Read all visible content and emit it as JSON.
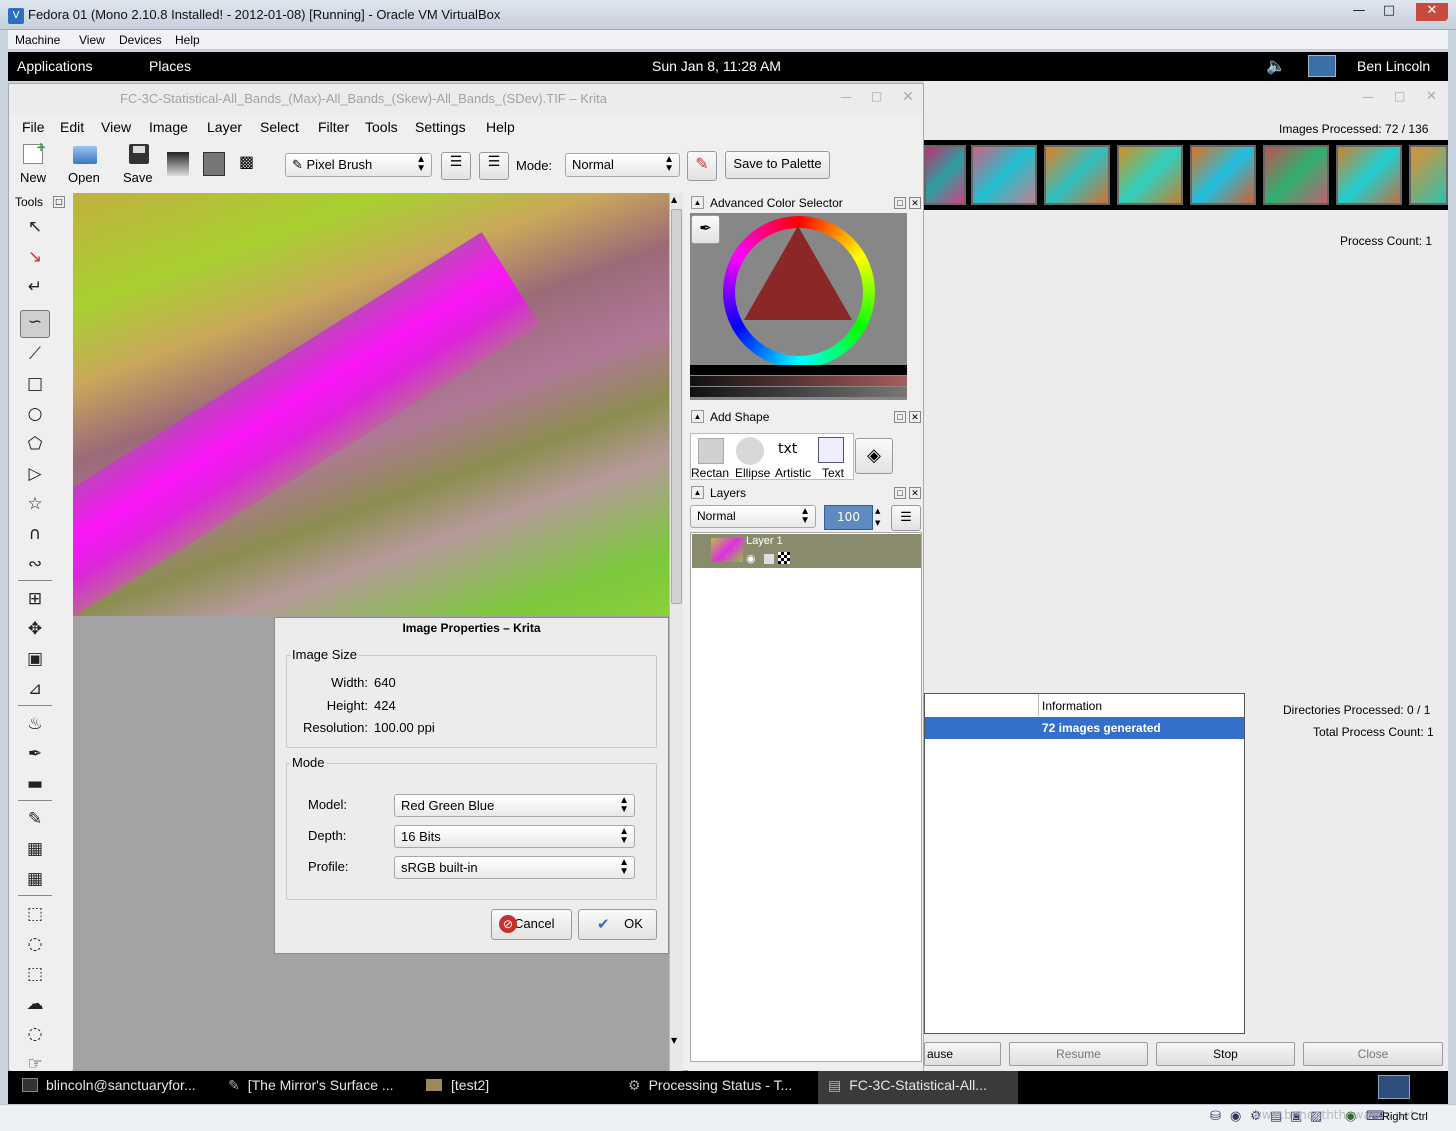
{
  "vbox": {
    "title": "Fedora 01 (Mono 2.10.8 Installed! - 2012-01-08) [Running] - Oracle VM VirtualBox",
    "menu": [
      "Machine",
      "View",
      "Devices",
      "Help"
    ],
    "host_key": "Right Ctrl"
  },
  "panel": {
    "applications": "Applications",
    "places": "Places",
    "clock": "Sun Jan  8, 11:28 AM",
    "user": "Ben Lincoln"
  },
  "krita": {
    "title": "FC-3C-Statistical-All_Bands_(Max)-All_Bands_(Skew)-All_Bands_(SDev).TIF – Krita",
    "menu": [
      "File",
      "Edit",
      "View",
      "Image",
      "Layer",
      "Select",
      "Filter",
      "Tools",
      "Settings",
      "Help"
    ],
    "toolbar": {
      "new": "New",
      "open": "Open",
      "save": "Save",
      "brush": "Pixel Brush",
      "mode_label": "Mode:",
      "mode_value": "Normal",
      "save_palette": "Save to Palette"
    },
    "tools_header": "Tools",
    "dockers": {
      "color_selector": "Advanced Color Selector",
      "add_shape": "Add Shape",
      "shapes": [
        "Rectan",
        "Ellipse",
        "Artistic",
        "Text"
      ],
      "layers": "Layers",
      "blend_mode": "Normal",
      "opacity": "100",
      "layer_name": "Layer 1"
    }
  },
  "dialog": {
    "title": "Image Properties – Krita",
    "image_size_group": "Image Size",
    "width_label": "Width:",
    "width_value": "640",
    "height_label": "Height:",
    "height_value": "424",
    "resolution_label": "Resolution:",
    "resolution_value": "100.00 ppi",
    "mode_group": "Mode",
    "model_label": "Model:",
    "model_value": "Red Green Blue",
    "depth_label": "Depth:",
    "depth_value": "16 Bits",
    "profile_label": "Profile:",
    "profile_value": "sRGB built-in",
    "cancel": "Cancel",
    "ok": "OK"
  },
  "processing": {
    "images_processed": "Images Processed: 72 / 136",
    "process_count": "Process Count: 1",
    "info_header": "Information",
    "info_row": "72 images generated",
    "dirs_processed": "Directories Processed: 0 / 1",
    "total_process_count": "Total Process Count: 1",
    "buttons": [
      "ause",
      "Resume",
      "Stop",
      "Close"
    ]
  },
  "taskbar": [
    "blincoln@sanctuaryfor...",
    "[The Mirror's Surface ...",
    "[test2]",
    "Processing Status - T...",
    "FC-3C-Statistical-All..."
  ],
  "watermark": "www.beneaththewaves.net"
}
